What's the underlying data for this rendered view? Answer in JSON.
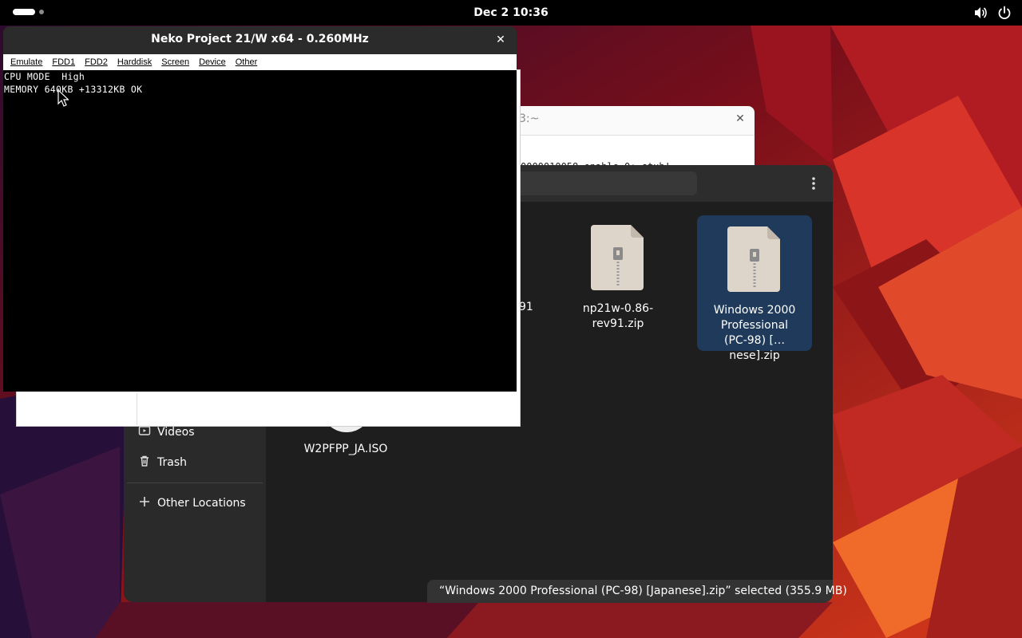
{
  "topbar": {
    "clock": "Dec 2  10:36",
    "icons": [
      "activities-indicator",
      "volume-icon",
      "power-icon"
    ]
  },
  "neko_window": {
    "title": "Neko Project 21/W x64 -  0.260MHz",
    "menu": [
      "Emulate",
      "FDD1",
      "FDD2",
      "Harddisk",
      "Screen",
      "Device",
      "Other"
    ],
    "screen_lines": [
      "CPU MODE  High",
      "MEMORY 640KB +13312KB OK"
    ]
  },
  "terminal_window": {
    "title_fragment": "3:~",
    "line_fragment": "0000010058 enable 0: stub!"
  },
  "file_manager": {
    "sidebar": [
      {
        "label": "Videos",
        "icon": "videos-icon"
      },
      {
        "label": "Trash",
        "icon": "trash-icon"
      },
      {
        "label": "Other Locations",
        "icon": "plus-icon"
      }
    ],
    "partial_label": "91",
    "files": [
      {
        "name_lines": [
          "np21w-0.86-",
          "rev91.zip"
        ],
        "icon": "zip-archive-icon",
        "selected": false
      },
      {
        "name_lines": [
          "Windows 2000",
          "Professional",
          "(PC-98) […nese].zip"
        ],
        "icon": "zip-archive-icon",
        "selected": true
      }
    ],
    "iso_file": "W2PFPP_JA.ISO",
    "status": "“Windows 2000 Professional (PC-98) [Japanese].zip” selected  (355.9 MB)"
  },
  "colors": {
    "topbar": "#000000",
    "window_dark": "#2b2b2b",
    "selection": "#1f3a5a",
    "wallpaper_red": "#c4201a"
  }
}
